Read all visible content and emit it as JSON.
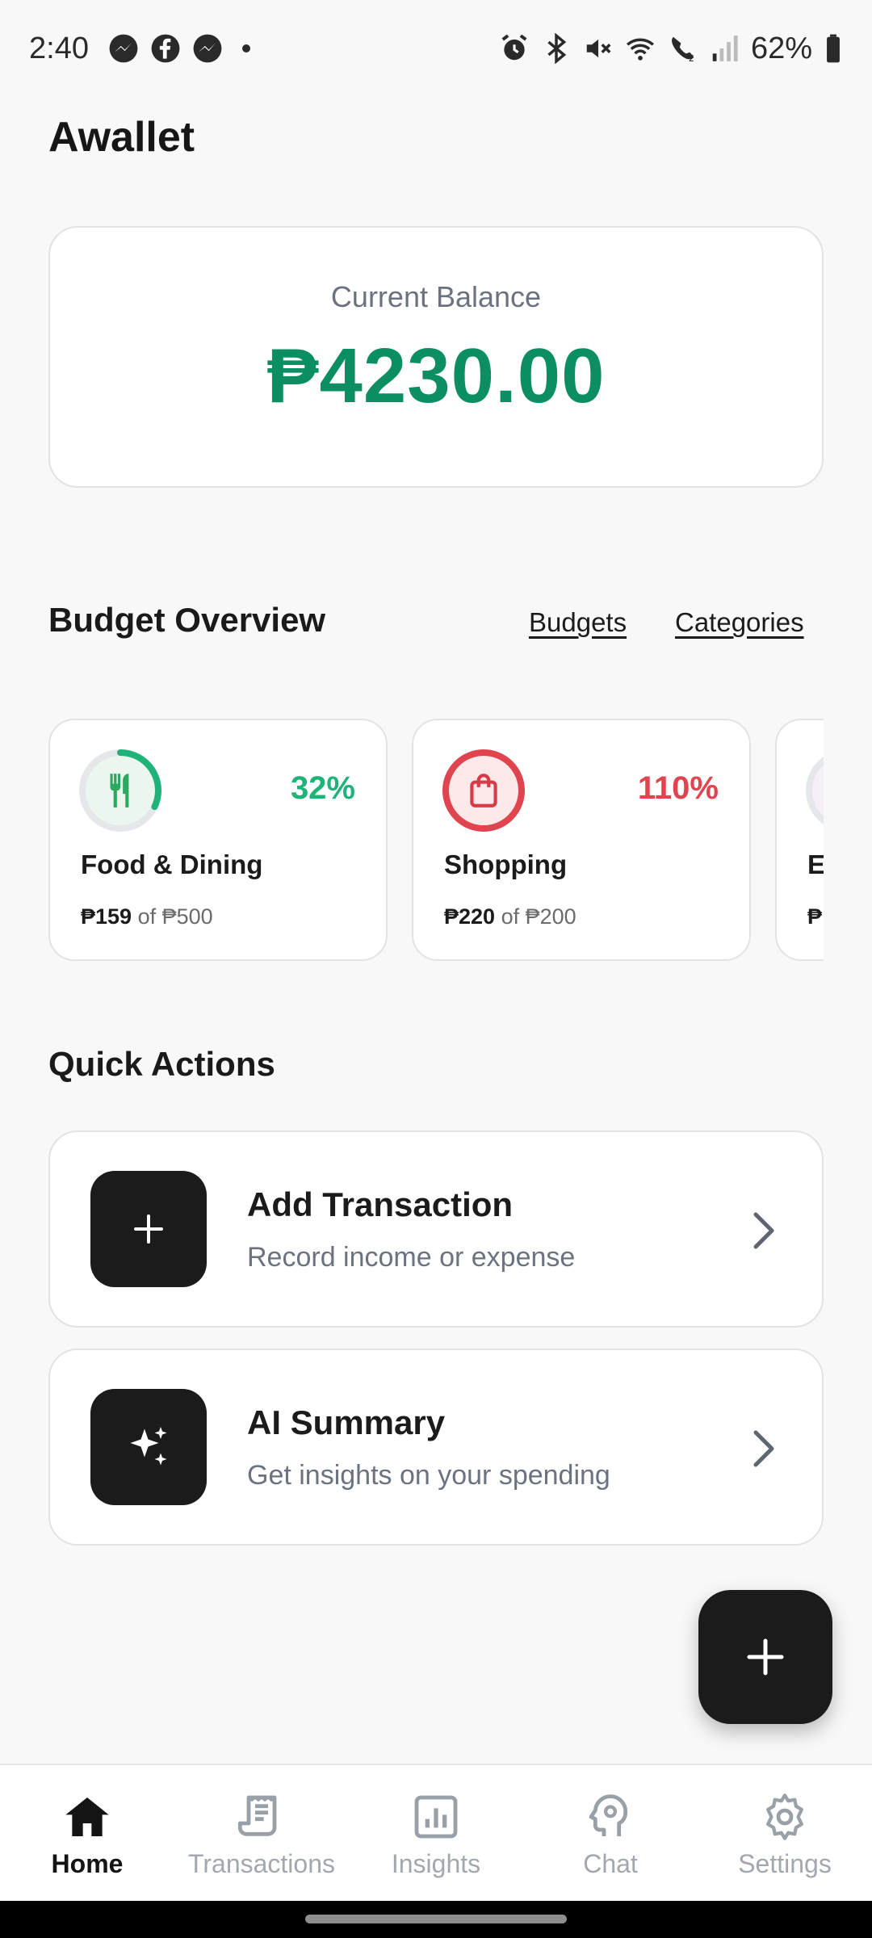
{
  "status_bar": {
    "time": "2:40",
    "battery": "62%",
    "left_icons": [
      "messenger-icon",
      "facebook-icon",
      "messenger-icon",
      "dot-icon"
    ],
    "right_icons": [
      "alarm-icon",
      "bluetooth-icon",
      "mute-icon",
      "wifi-icon",
      "wifi-calling-icon",
      "signal-icon",
      "battery-icon"
    ]
  },
  "app": {
    "title": "Awallet"
  },
  "balance": {
    "label": "Current Balance",
    "amount": "₱4230.00",
    "color": "#0b8f62"
  },
  "budget_overview": {
    "title": "Budget Overview",
    "links": {
      "budgets": "Budgets",
      "categories": "Categories"
    },
    "cards": [
      {
        "icon": "utensils-icon",
        "percent": "32%",
        "progress": 0.32,
        "color": "#1fb37a",
        "name": "Food & Dining",
        "spent": "₱159",
        "of": "of ₱500"
      },
      {
        "icon": "shopping-bag-icon",
        "percent": "110%",
        "progress": 1.0,
        "color": "#e0454f",
        "name": "Shopping",
        "spent": "₱220",
        "of": "of ₱200"
      },
      {
        "icon": "category-icon",
        "percent": "",
        "progress": 0,
        "color": "#c9a6d8",
        "name": "E",
        "spent": "₱",
        "of": ""
      }
    ]
  },
  "quick_actions": {
    "title": "Quick Actions",
    "items": [
      {
        "icon": "plus-icon",
        "title": "Add Transaction",
        "subtitle": "Record income or expense"
      },
      {
        "icon": "sparkles-icon",
        "title": "AI Summary",
        "subtitle": "Get insights on your spending"
      }
    ]
  },
  "fab": {
    "icon": "plus-icon"
  },
  "bottom_nav": {
    "items": [
      {
        "icon": "home-icon",
        "label": "Home",
        "active": true
      },
      {
        "icon": "receipt-icon",
        "label": "Transactions",
        "active": false
      },
      {
        "icon": "bar-chart-icon",
        "label": "Insights",
        "active": false
      },
      {
        "icon": "ai-head-icon",
        "label": "Chat",
        "active": false
      },
      {
        "icon": "settings-icon",
        "label": "Settings",
        "active": false
      }
    ]
  }
}
